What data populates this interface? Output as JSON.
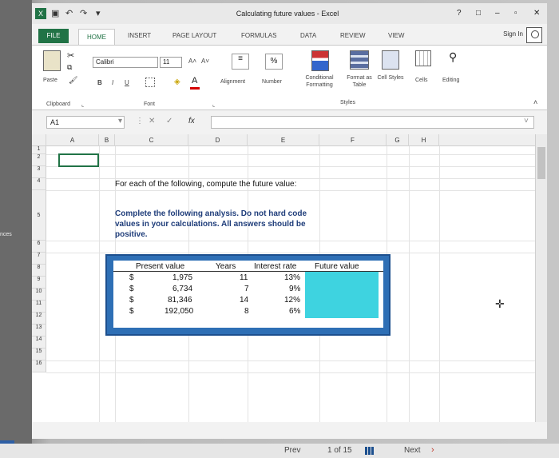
{
  "window": {
    "title": "Calculating future values - Excel",
    "controls": [
      "?",
      "□",
      "–",
      "▫",
      "✕"
    ]
  },
  "quick_access": {
    "undo": "↶",
    "redo": "↷"
  },
  "tabs": [
    "FILE",
    "HOME",
    "INSERT",
    "PAGE LAYOUT",
    "FORMULAS",
    "DATA",
    "REVIEW",
    "VIEW"
  ],
  "account": {
    "sign_in": "Sign In"
  },
  "ribbon": {
    "paste": "Paste",
    "clipboard_group": "Clipboard",
    "font_name": "Calibri",
    "font_size": "11",
    "font_group": "Font",
    "bold": "B",
    "italic": "I",
    "underline": "U",
    "alignment": "Alignment",
    "number": "Number",
    "number_symbol": "%",
    "conditional_formatting": "Conditional Formatting",
    "format_as_table": "Format as Table",
    "cell_styles": "Cell Styles",
    "styles_group": "Styles",
    "cells": "Cells",
    "editing": "Editing",
    "grow_font": "A˄",
    "shrink_font": "A˅"
  },
  "formula_bar": {
    "name_box": "A1",
    "fx": "fx",
    "cancel": "✕",
    "enter": "✓",
    "value": ""
  },
  "columns": [
    "A",
    "B",
    "C",
    "D",
    "E",
    "F",
    "G",
    "H"
  ],
  "rows": [
    "1",
    "2",
    "3",
    "4",
    "5",
    "6",
    "7",
    "8",
    "9",
    "10",
    "11",
    "12",
    "13",
    "14",
    "15",
    "16"
  ],
  "sheet": {
    "instruction": "For each of the following, compute the future value:",
    "note_line1": "Complete the following analysis. Do not hard code",
    "note_line2": "values in your calculations. All answers should be",
    "note_line3": "positive."
  },
  "table": {
    "headers": [
      "Present value",
      "Years",
      "Interest rate",
      "Future value"
    ],
    "rows": [
      {
        "currency": "$",
        "present_value": "1,975",
        "years": "11",
        "rate": "13%"
      },
      {
        "currency": "$",
        "present_value": "6,734",
        "years": "7",
        "rate": "9%"
      },
      {
        "currency": "$",
        "present_value": "81,346",
        "years": "14",
        "rate": "12%"
      },
      {
        "currency": "$",
        "present_value": "192,050",
        "years": "8",
        "rate": "6%"
      }
    ],
    "future_value_fill": "#3ed3e0"
  },
  "side_text": "nces",
  "pager": {
    "prev": "Prev",
    "page": "1 of 15",
    "next": "Next"
  },
  "colors": {
    "excel_green": "#217346",
    "table_blue": "#2e6fb5",
    "note_blue": "#1f3d7a"
  }
}
